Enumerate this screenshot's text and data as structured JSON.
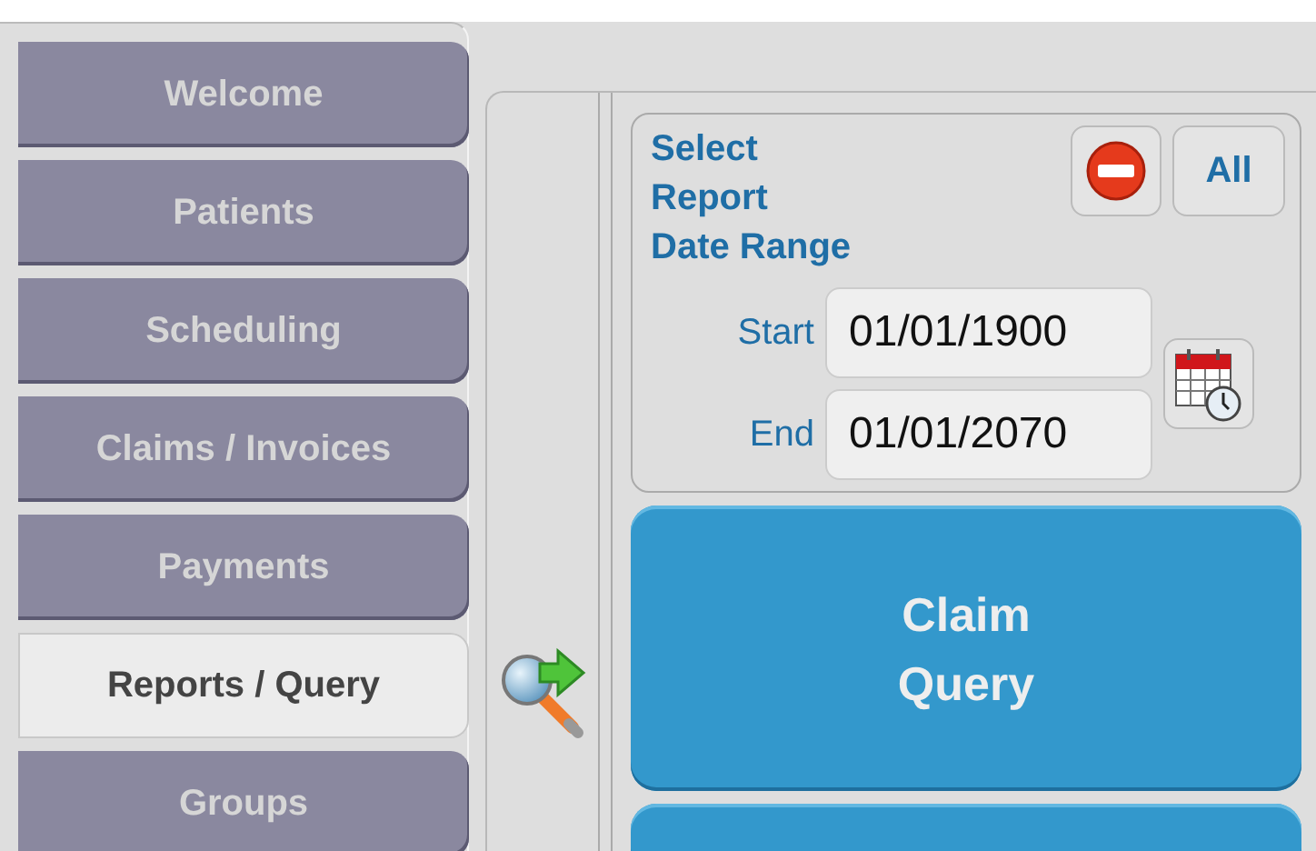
{
  "nav": [
    {
      "label": "Welcome",
      "selected": false
    },
    {
      "label": "Patients",
      "selected": false
    },
    {
      "label": "Scheduling",
      "selected": false
    },
    {
      "label": "Claims / Invoices",
      "selected": false
    },
    {
      "label": "Payments",
      "selected": false
    },
    {
      "label": "Reports / Query",
      "selected": true
    },
    {
      "label": "Groups",
      "selected": false
    }
  ],
  "date_range": {
    "title_lines": [
      "Select",
      "Report",
      "Date Range"
    ],
    "all_button": "All",
    "fields": [
      {
        "label": "Start",
        "value": "01/01/1900"
      },
      {
        "label": "End",
        "value": "01/01/2070"
      }
    ]
  },
  "query_buttons": [
    {
      "kind": "labelled",
      "label": "Claim Query"
    },
    {
      "kind": "cut"
    }
  ]
}
